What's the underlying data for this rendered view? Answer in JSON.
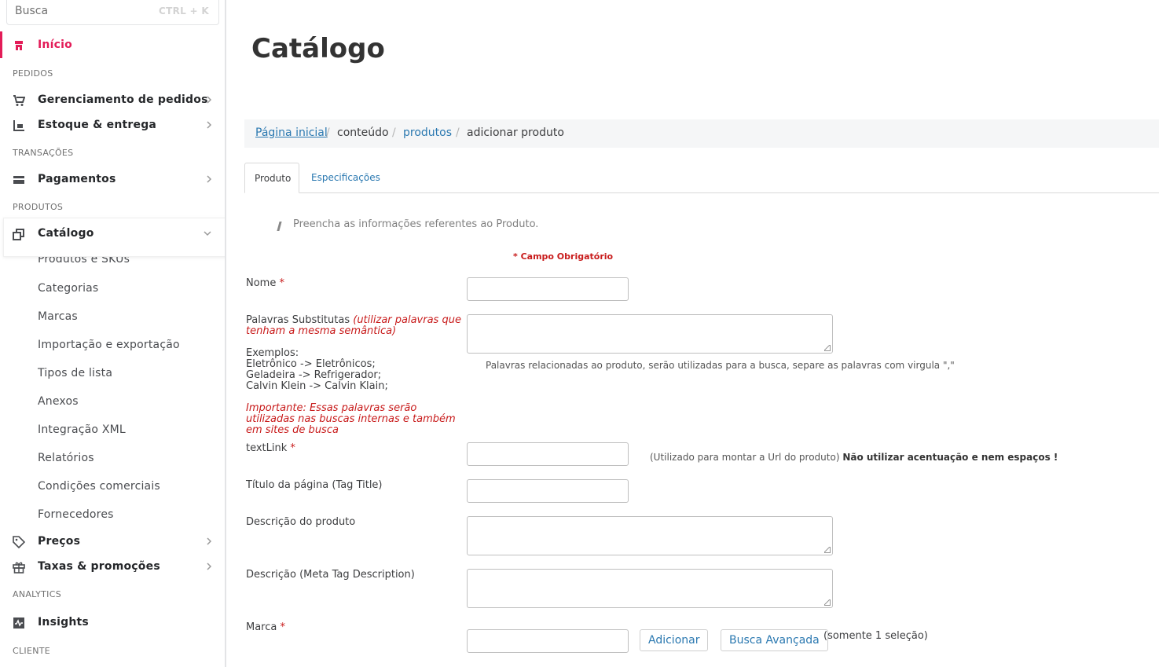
{
  "search": {
    "placeholder": "Busca",
    "shortcut": "CTRL + K"
  },
  "sidebar": {
    "home": "Início",
    "sections": {
      "orders": "PEDIDOS",
      "transactions": "TRANSAÇÕES",
      "products": "PRODUTOS",
      "analytics": "ANALYTICS",
      "client": "CLIENTE"
    },
    "items": {
      "orders_mgmt": "Gerenciamento de pedidos",
      "stock": "Estoque & entrega",
      "payments": "Pagamentos",
      "catalog": "Catálogo",
      "prices": "Preços",
      "taxes": "Taxas & promoções",
      "insights": "Insights"
    },
    "catalog_sub": [
      "Produtos e SKUs",
      "Categorias",
      "Marcas",
      "Importação e exportação",
      "Tipos de lista",
      "Anexos",
      "Integração XML",
      "Relatórios",
      "Condições comerciais",
      "Fornecedores"
    ],
    "accent": "#e31c58"
  },
  "main": {
    "title": "Catálogo",
    "breadcrumb": {
      "home": "Página inicial",
      "content": "conteúdo",
      "products": "produtos",
      "current": "adicionar produto",
      "sep": "/"
    },
    "tabs": [
      "Produto",
      "Especificações"
    ],
    "hint": "Preencha as informações referentes ao Produto.",
    "required_note": "* Campo Obrigatório",
    "form": {
      "name_label": "Nome",
      "star": "*",
      "keywords_label": "Palavras Substitutas",
      "keywords_hint": "(utilizar palavras que tenham a mesma semântica)",
      "examples_title": "Exemplos:",
      "examples": [
        "Eletrônico -> Eletrônicos;",
        "Geladeira -> Refrigerador;",
        "Calvin Klein -> Calvin Klain;"
      ],
      "important": "Importante: Essas palavras serão utilizadas nas buscas internas e também em sites de busca",
      "keywords_note": "Palavras relacionadas ao produto, serão utilizadas para a busca, separe as palavras com virgula \",\"",
      "textlink_label": "textLink",
      "textlink_note": "(Utilizado para montar a Url do produto)",
      "textlink_warning": "Não utilizar acentuação e nem espaços !",
      "page_title_label": "Título da página (Tag Title)",
      "description_label": "Descrição do produto",
      "meta_description_label": "Descrição (Meta Tag Description)",
      "brand_label": "Marca",
      "add_button": "Adicionar",
      "advanced_search_button": "Busca Avançada",
      "single_selection_note": "(somente 1 seleção)"
    }
  }
}
